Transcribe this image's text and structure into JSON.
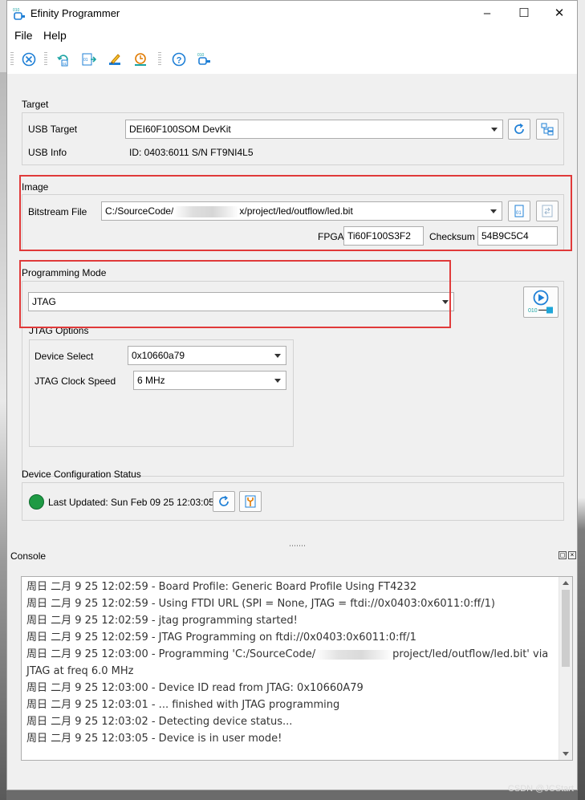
{
  "window": {
    "title": "Efinity Programmer",
    "minimize": "–",
    "maximize": "☐",
    "close": "✕"
  },
  "menu": {
    "file": "File",
    "help": "Help"
  },
  "target": {
    "section_title": "Target",
    "usb_target_label": "USB Target",
    "usb_target_value": "DEI60F100SOM DevKit",
    "usb_info_label": "USB Info",
    "usb_info_value": "ID: 0403:6011 S/N FT9NI4L5"
  },
  "image": {
    "section_title": "Image",
    "bitstream_label": "Bitstream File",
    "bitstream_prefix": "C:/SourceCode/",
    "bitstream_suffix": "x/project/led/outflow/led.bit",
    "fpga_label": "FPGA",
    "fpga_value": "Ti60F100S3F2",
    "checksum_label": "Checksum",
    "checksum_value": "54B9C5C4"
  },
  "programming": {
    "section_title": "Programming Mode",
    "mode_value": "JTAG",
    "jtag_options_title": "JTAG Options",
    "device_select_label": "Device Select",
    "device_select_value": "0x10660a79",
    "clock_label": "JTAG Clock Speed",
    "clock_value": "6 MHz"
  },
  "status": {
    "section_title": "Device Configuration Status",
    "last_updated": "Last Updated: Sun Feb 09 25 12:03:05",
    "indicator_color": "#1e9a44"
  },
  "console": {
    "title": "Console",
    "lines": [
      "周日 二月 9 25 12:02:59 - Board Profile: Generic Board Profile Using FT4232",
      "周日 二月 9 25 12:02:59 - Using FTDI URL (SPI = None, JTAG = ftdi://0x0403:0x6011:0:ff/1)",
      "周日 二月 9 25 12:02:59 - jtag programming started!",
      "周日 二月 9 25 12:02:59 - JTAG Programming on ftdi://0x0403:0x6011:0:ff/1",
      "周日 二月 9 25 12:03:00 - Programming 'C:/SourceCode/",
      "project/led/outflow/led.bit' via",
      "JTAG at freq 6.0 MHz",
      "周日 二月 9 25 12:03:00 - Device ID read from JTAG: 0x10660A79",
      "周日 二月 9 25 12:03:01 - ... finished with JTAG programming",
      "周日 二月 9 25 12:03:02 - Detecting device status...",
      "周日 二月 9 25 12:03:05 - Device is in user mode!"
    ]
  },
  "watermark": "CSDN @JCStart",
  "accent_red": "#e03a3a",
  "accent_blue": "#1e7fd6"
}
